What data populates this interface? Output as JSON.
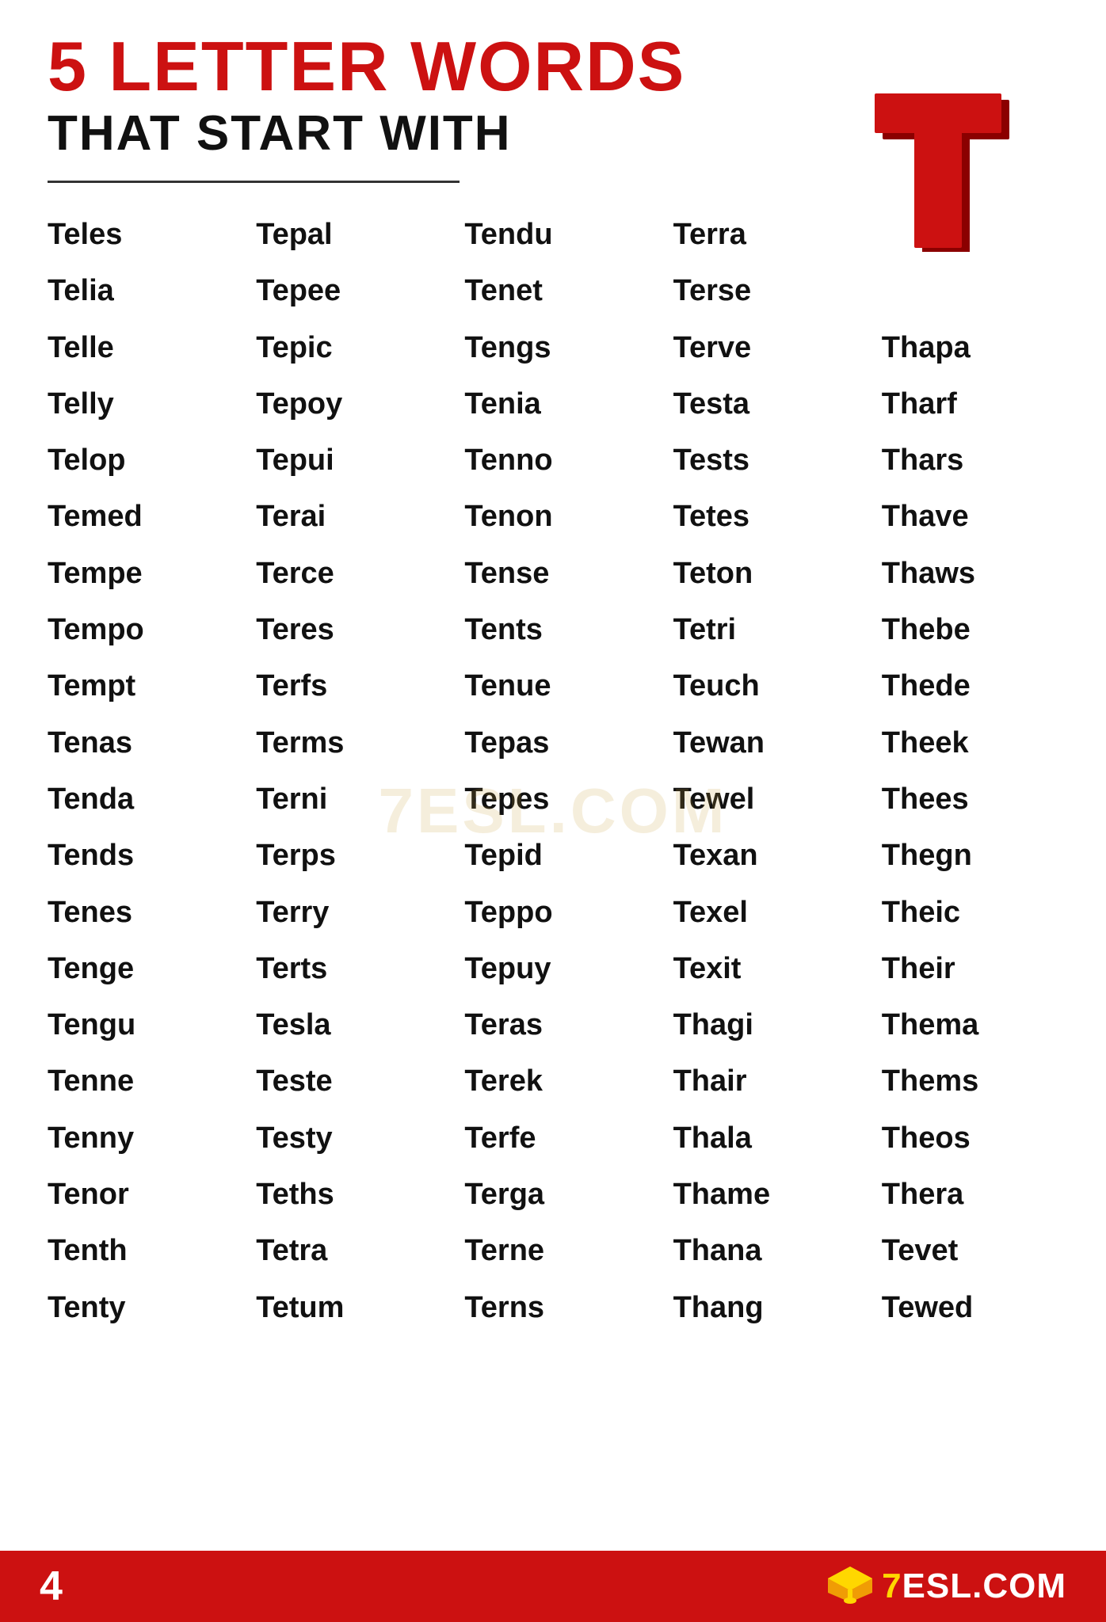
{
  "header": {
    "title_line1": "5 LETTER WORDS",
    "subtitle": "THAT START WITH",
    "letter": "T"
  },
  "watermark": "7ESL.COM",
  "words": [
    [
      "Teles",
      "Tepal",
      "Tendu",
      "Terra",
      ""
    ],
    [
      "Telia",
      "Tepee",
      "Tenet",
      "Terse",
      ""
    ],
    [
      "Telle",
      "Tepic",
      "Tengs",
      "Terve",
      "Thapa"
    ],
    [
      "Telly",
      "Tepoy",
      "Tenia",
      "Testa",
      "Tharf"
    ],
    [
      "Telop",
      "Tepui",
      "Tenno",
      "Tests",
      "Thars"
    ],
    [
      "Temed",
      "Terai",
      "Tenon",
      "Tetes",
      "Thave"
    ],
    [
      "Tempe",
      "Terce",
      "Tense",
      "Teton",
      "Thaws"
    ],
    [
      "Tempo",
      "Teres",
      "Tents",
      "Tetri",
      "Thebe"
    ],
    [
      "Tempt",
      "Terfs",
      "Tenue",
      "Teuch",
      "Thede"
    ],
    [
      "Tenas",
      "Terms",
      "Tepas",
      "Tewan",
      "Theek"
    ],
    [
      "Tenda",
      "Terni",
      "Tepes",
      "Tewel",
      "Thees"
    ],
    [
      "Tends",
      "Terps",
      "Tepid",
      "Texan",
      "Thegn"
    ],
    [
      "Tenes",
      "Terry",
      "Teppo",
      "Texel",
      "Theic"
    ],
    [
      "Tenge",
      "Terts",
      "Tepuy",
      "Texit",
      "Their"
    ],
    [
      "Tengu",
      "Tesla",
      "Teras",
      "Thagi",
      "Thema"
    ],
    [
      "Tenne",
      "Teste",
      "Terek",
      "Thair",
      "Thems"
    ],
    [
      "Tenny",
      "Testy",
      "Terfe",
      "Thala",
      "Theos"
    ],
    [
      "Tenor",
      "Teths",
      "Terga",
      "Thame",
      "Thera"
    ],
    [
      "Tenth",
      "Tetra",
      "Terne",
      "Thana",
      "Tevet"
    ],
    [
      "Tenty",
      "Tetum",
      "Terns",
      "Thang",
      "Tewed"
    ]
  ],
  "footer": {
    "page_number": "4",
    "logo_text": "7ESL.COM"
  }
}
